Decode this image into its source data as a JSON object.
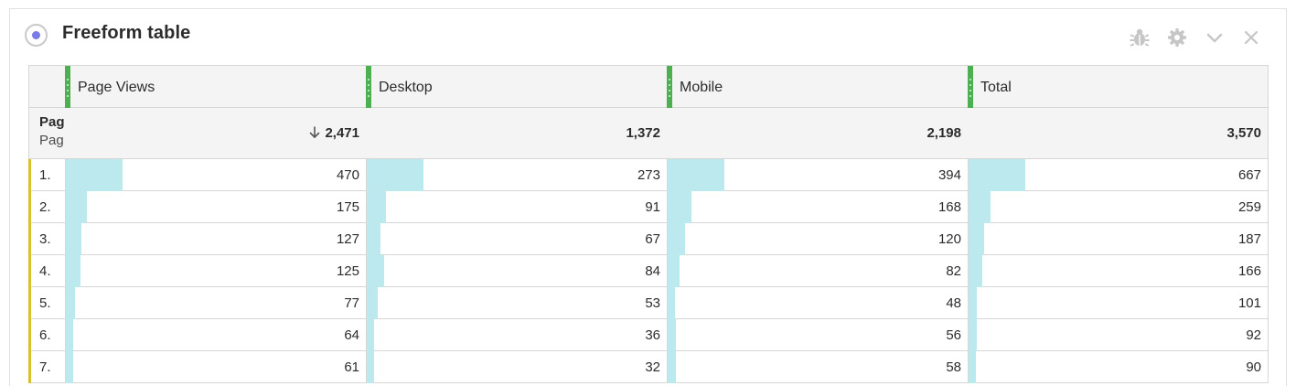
{
  "panel": {
    "title": "Freeform table",
    "icons": [
      "bug-icon",
      "gear-icon",
      "chevron-down-icon",
      "close-icon"
    ]
  },
  "table": {
    "columns": [
      {
        "label": "Page Views"
      },
      {
        "label": "Desktop"
      },
      {
        "label": "Mobile"
      },
      {
        "label": "Total"
      }
    ],
    "dimension": {
      "label_line1": "Pag",
      "label_line2": "Pag"
    },
    "totals": [
      "2,471",
      "1,372",
      "2,198",
      "3,570"
    ],
    "totals_numeric": [
      2471,
      1372,
      2198,
      3570
    ],
    "sort_column": "Page Views",
    "rows": [
      {
        "rank": "1.",
        "cells": [
          "470",
          "273",
          "394",
          "667"
        ],
        "values": [
          470,
          273,
          394,
          667
        ]
      },
      {
        "rank": "2.",
        "cells": [
          "175",
          "91",
          "168",
          "259"
        ],
        "values": [
          175,
          91,
          168,
          259
        ]
      },
      {
        "rank": "3.",
        "cells": [
          "127",
          "67",
          "120",
          "187"
        ],
        "values": [
          127,
          67,
          120,
          187
        ]
      },
      {
        "rank": "4.",
        "cells": [
          "125",
          "84",
          "82",
          "166"
        ],
        "values": [
          125,
          84,
          82,
          166
        ]
      },
      {
        "rank": "5.",
        "cells": [
          "77",
          "53",
          "48",
          "101"
        ],
        "values": [
          77,
          53,
          48,
          101
        ]
      },
      {
        "rank": "6.",
        "cells": [
          "64",
          "36",
          "56",
          "92"
        ],
        "values": [
          64,
          36,
          56,
          92
        ]
      },
      {
        "rank": "7.",
        "cells": [
          "61",
          "32",
          "58",
          "90"
        ],
        "values": [
          61,
          32,
          58,
          90
        ]
      }
    ]
  },
  "colors": {
    "bar": "#bce9ed",
    "column_grip": "#4caf50",
    "row_accent": "#d9c12a",
    "radio_dot": "#7a7be6"
  }
}
